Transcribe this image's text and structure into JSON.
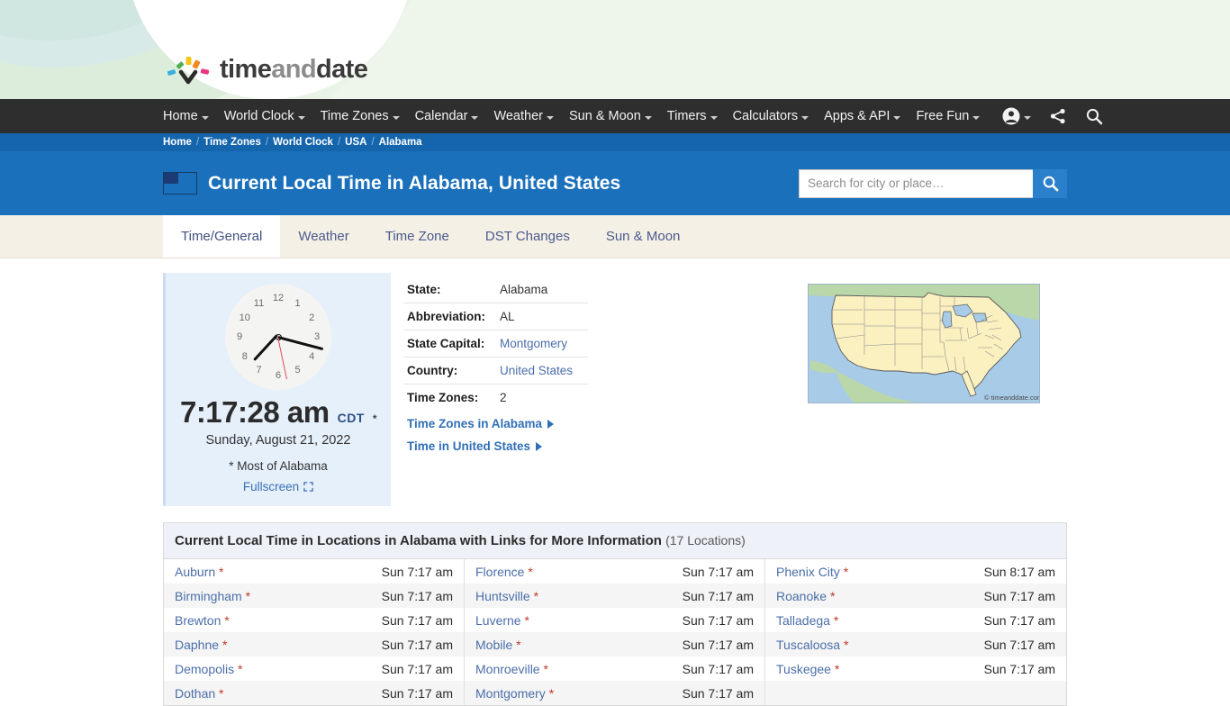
{
  "brand": {
    "time": "time",
    "and": "and",
    "date": "date"
  },
  "nav": {
    "items": [
      {
        "label": "Home",
        "caret": true
      },
      {
        "label": "World Clock",
        "caret": true
      },
      {
        "label": "Time Zones",
        "caret": true
      },
      {
        "label": "Calendar",
        "caret": true
      },
      {
        "label": "Weather",
        "caret": true
      },
      {
        "label": "Sun & Moon",
        "caret": true
      },
      {
        "label": "Timers",
        "caret": true
      },
      {
        "label": "Calculators",
        "caret": true
      },
      {
        "label": "Apps & API",
        "caret": true
      },
      {
        "label": "Free Fun",
        "caret": true
      }
    ],
    "icons": [
      {
        "name": "account-icon"
      },
      {
        "name": "share-icon"
      },
      {
        "name": "search-icon"
      }
    ]
  },
  "breadcrumb": {
    "items": [
      "Home",
      "Time Zones",
      "World Clock",
      "USA",
      "Alabama"
    ],
    "separator": "/"
  },
  "header": {
    "title": "Current Local Time in Alabama, United States",
    "flag": "us-flag-icon"
  },
  "search": {
    "placeholder": "Search for city or place…",
    "value": "",
    "button_icon": "search-icon"
  },
  "tabs": [
    {
      "label": "Time/General",
      "active": true
    },
    {
      "label": "Weather",
      "active": false
    },
    {
      "label": "Time Zone",
      "active": false
    },
    {
      "label": "DST Changes",
      "active": false
    },
    {
      "label": "Sun & Moon",
      "active": false
    }
  ],
  "clock": {
    "numbers": [
      "12",
      "1",
      "2",
      "3",
      "4",
      "5",
      "6",
      "7",
      "8",
      "9",
      "10",
      "11"
    ],
    "time": "7:17:28 am",
    "timezone": "CDT",
    "tz_star": "*",
    "date": "Sunday, August 21, 2022",
    "note": "* Most of Alabama",
    "fullscreen": "Fullscreen",
    "fullscreen_icon": "expand-icon",
    "hour_deg": 222.6,
    "minute_deg": 104.8,
    "second_deg": 168.0
  },
  "info": {
    "rows": [
      {
        "label": "State:",
        "value": "Alabama",
        "link": false
      },
      {
        "label": "Abbreviation:",
        "value": "AL",
        "link": false
      },
      {
        "label": "State Capital:",
        "value": "Montgomery",
        "link": true
      },
      {
        "label": "Country:",
        "value": "United States",
        "link": true
      },
      {
        "label": "Time Zones:",
        "value": "2",
        "link": false
      }
    ],
    "links": [
      {
        "label": "Time Zones in Alabama"
      },
      {
        "label": "Time in United States"
      }
    ]
  },
  "map": {
    "name": "usa-map",
    "credit": "© timeanddate.com",
    "ocean_color": "#a8cbe8",
    "land_color": "#faf0c0",
    "neighbor_color": "#b9d7a8"
  },
  "locations": {
    "heading": "Current Local Time in Locations in Alabama with Links for More Information",
    "count": "(17 Locations)",
    "columns": [
      [
        {
          "name": "Auburn",
          "star": "*",
          "time": "Sun 7:17 am"
        },
        {
          "name": "Birmingham",
          "star": "*",
          "time": "Sun 7:17 am"
        },
        {
          "name": "Brewton",
          "star": "*",
          "time": "Sun 7:17 am"
        },
        {
          "name": "Daphne",
          "star": "*",
          "time": "Sun 7:17 am"
        },
        {
          "name": "Demopolis",
          "star": "*",
          "time": "Sun 7:17 am"
        },
        {
          "name": "Dothan",
          "star": "*",
          "time": "Sun 7:17 am"
        }
      ],
      [
        {
          "name": "Florence",
          "star": "*",
          "time": "Sun 7:17 am"
        },
        {
          "name": "Huntsville",
          "star": "*",
          "time": "Sun 7:17 am"
        },
        {
          "name": "Luverne",
          "star": "*",
          "time": "Sun 7:17 am"
        },
        {
          "name": "Mobile",
          "star": "*",
          "time": "Sun 7:17 am"
        },
        {
          "name": "Monroeville",
          "star": "*",
          "time": "Sun 7:17 am"
        },
        {
          "name": "Montgomery",
          "star": "*",
          "time": "Sun 7:17 am"
        }
      ],
      [
        {
          "name": "Phenix City",
          "star": "*",
          "time": "Sun 8:17 am"
        },
        {
          "name": "Roanoke",
          "star": "*",
          "time": "Sun 7:17 am"
        },
        {
          "name": "Talladega",
          "star": "*",
          "time": "Sun 7:17 am"
        },
        {
          "name": "Tuscaloosa",
          "star": "*",
          "time": "Sun 7:17 am"
        },
        {
          "name": "Tuskegee",
          "star": "*",
          "time": "Sun 7:17 am"
        },
        {
          "name": "",
          "star": "",
          "time": ""
        }
      ]
    ]
  },
  "colors": {
    "nav_bg": "#2e2e2e",
    "crumb_bg": "#1565ad",
    "title_bg": "#1b70bb",
    "tab_bg": "#f5f0e6",
    "link": "#4b6ea9",
    "clock_panel": "#e6f0fb"
  }
}
